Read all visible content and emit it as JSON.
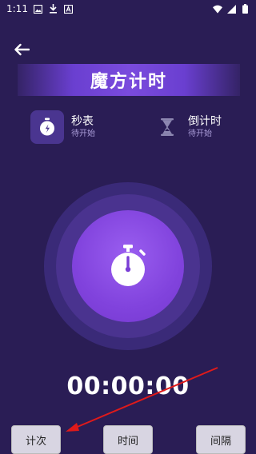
{
  "status_bar": {
    "time": "1:11"
  },
  "header": {
    "title": "魔方计时"
  },
  "modes": [
    {
      "title": "秒表",
      "status": "待开始",
      "icon": "stopwatch-icon"
    },
    {
      "title": "倒计时",
      "status": "待开始",
      "icon": "hourglass-icon"
    }
  ],
  "timer": {
    "display": "00:00:00"
  },
  "buttons": {
    "lap": "计次",
    "time": "时间",
    "interval": "间隔"
  },
  "colors": {
    "background": "#2a1d55",
    "accent": "#8143dd",
    "annotation_arrow": "#e01a1a"
  }
}
